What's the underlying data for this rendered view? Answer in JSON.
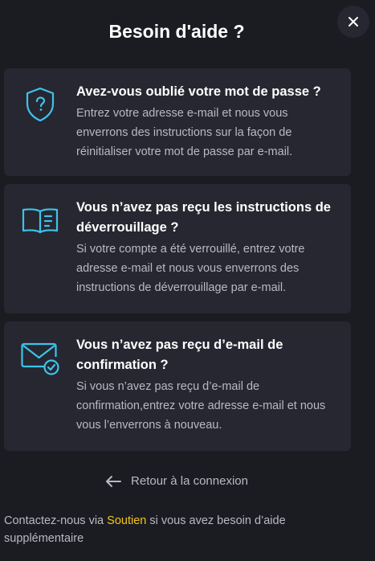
{
  "modal": {
    "title": "Besoin d'aide ?",
    "close_icon": "close-icon"
  },
  "cards": [
    {
      "icon": "shield-question-icon",
      "title": "Avez-vous oublié votre mot de passe ?",
      "text": "Entrez votre adresse e-mail et nous vous enverrons des instructions sur la façon de réinitialiser votre mot de passe par e-mail."
    },
    {
      "icon": "book-icon",
      "title": "Vous n’avez pas reçu les instructions de déverrouillage ?",
      "text": "Si votre compte a été verrouillé, entrez votre adresse e-mail et nous vous enverrons des instructions de déverrouillage par e-mail."
    },
    {
      "icon": "mail-check-icon",
      "title": "Vous n’avez pas reçu d’e-mail de confirmation ?",
      "text": "Si vous n’avez pas reçu d’e-mail de confirmation,entrez votre adresse e-mail et nous vous l’enverrons à nouveau."
    }
  ],
  "back": {
    "icon": "arrow-left-icon",
    "label": "Retour à la connexion"
  },
  "footer": {
    "prefix": "Contactez-nous via ",
    "link": "Soutien",
    "suffix": " si vous avez besoin d’aide supplémentaire"
  },
  "colors": {
    "background": "#1b1c22",
    "card": "#262731",
    "accent_icon": "#3ec3ea",
    "link": "#f5c518",
    "muted_text": "#b8bac2"
  }
}
